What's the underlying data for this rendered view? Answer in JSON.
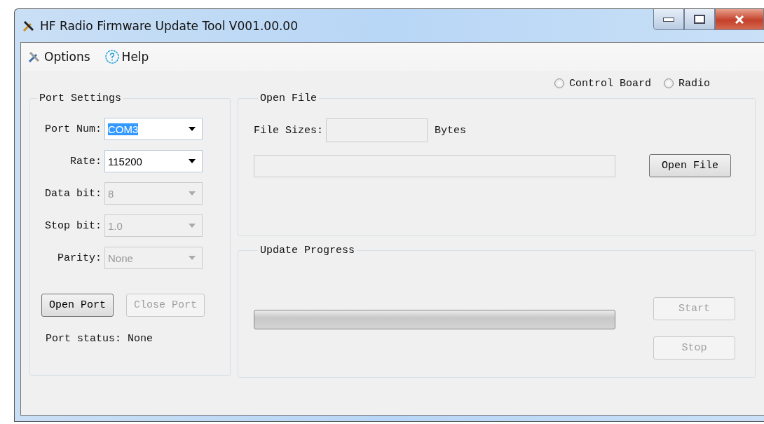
{
  "window": {
    "title": "HF Radio Firmware Update Tool V001.00.00"
  },
  "menu": [
    {
      "kind": "options",
      "label": "Options"
    },
    {
      "kind": "help",
      "label": "Help"
    }
  ],
  "target": [
    {
      "label": "Control Board",
      "selected": false
    },
    {
      "label": "Radio",
      "selected": false
    }
  ],
  "port_settings": {
    "title": "Port Settings",
    "fields": [
      {
        "label": "Port Num:",
        "value": "COM3",
        "disabled": false,
        "highlighted": true
      },
      {
        "label": "Rate:",
        "value": "115200",
        "disabled": false,
        "highlighted": false
      },
      {
        "label": "Data bit:",
        "value": "8",
        "disabled": true,
        "highlighted": false
      },
      {
        "label": "Stop bit:",
        "value": "1.0",
        "disabled": true,
        "highlighted": false
      },
      {
        "label": "Parity:",
        "value": "None",
        "disabled": true,
        "highlighted": false
      }
    ],
    "buttons": [
      {
        "label": "Open Port",
        "disabled": false
      },
      {
        "label": "Close Port",
        "disabled": true
      }
    ],
    "status": "Port status: None"
  },
  "open_file": {
    "title": "Open File",
    "size_label": "File Sizes:",
    "size_unit": "Bytes",
    "button": {
      "label": "Open File",
      "disabled": false
    }
  },
  "update_progress": {
    "title": "Update Progress",
    "level": 0,
    "buttons": [
      {
        "label": "Start",
        "disabled": true
      },
      {
        "label": "Stop",
        "disabled": true
      }
    ]
  }
}
